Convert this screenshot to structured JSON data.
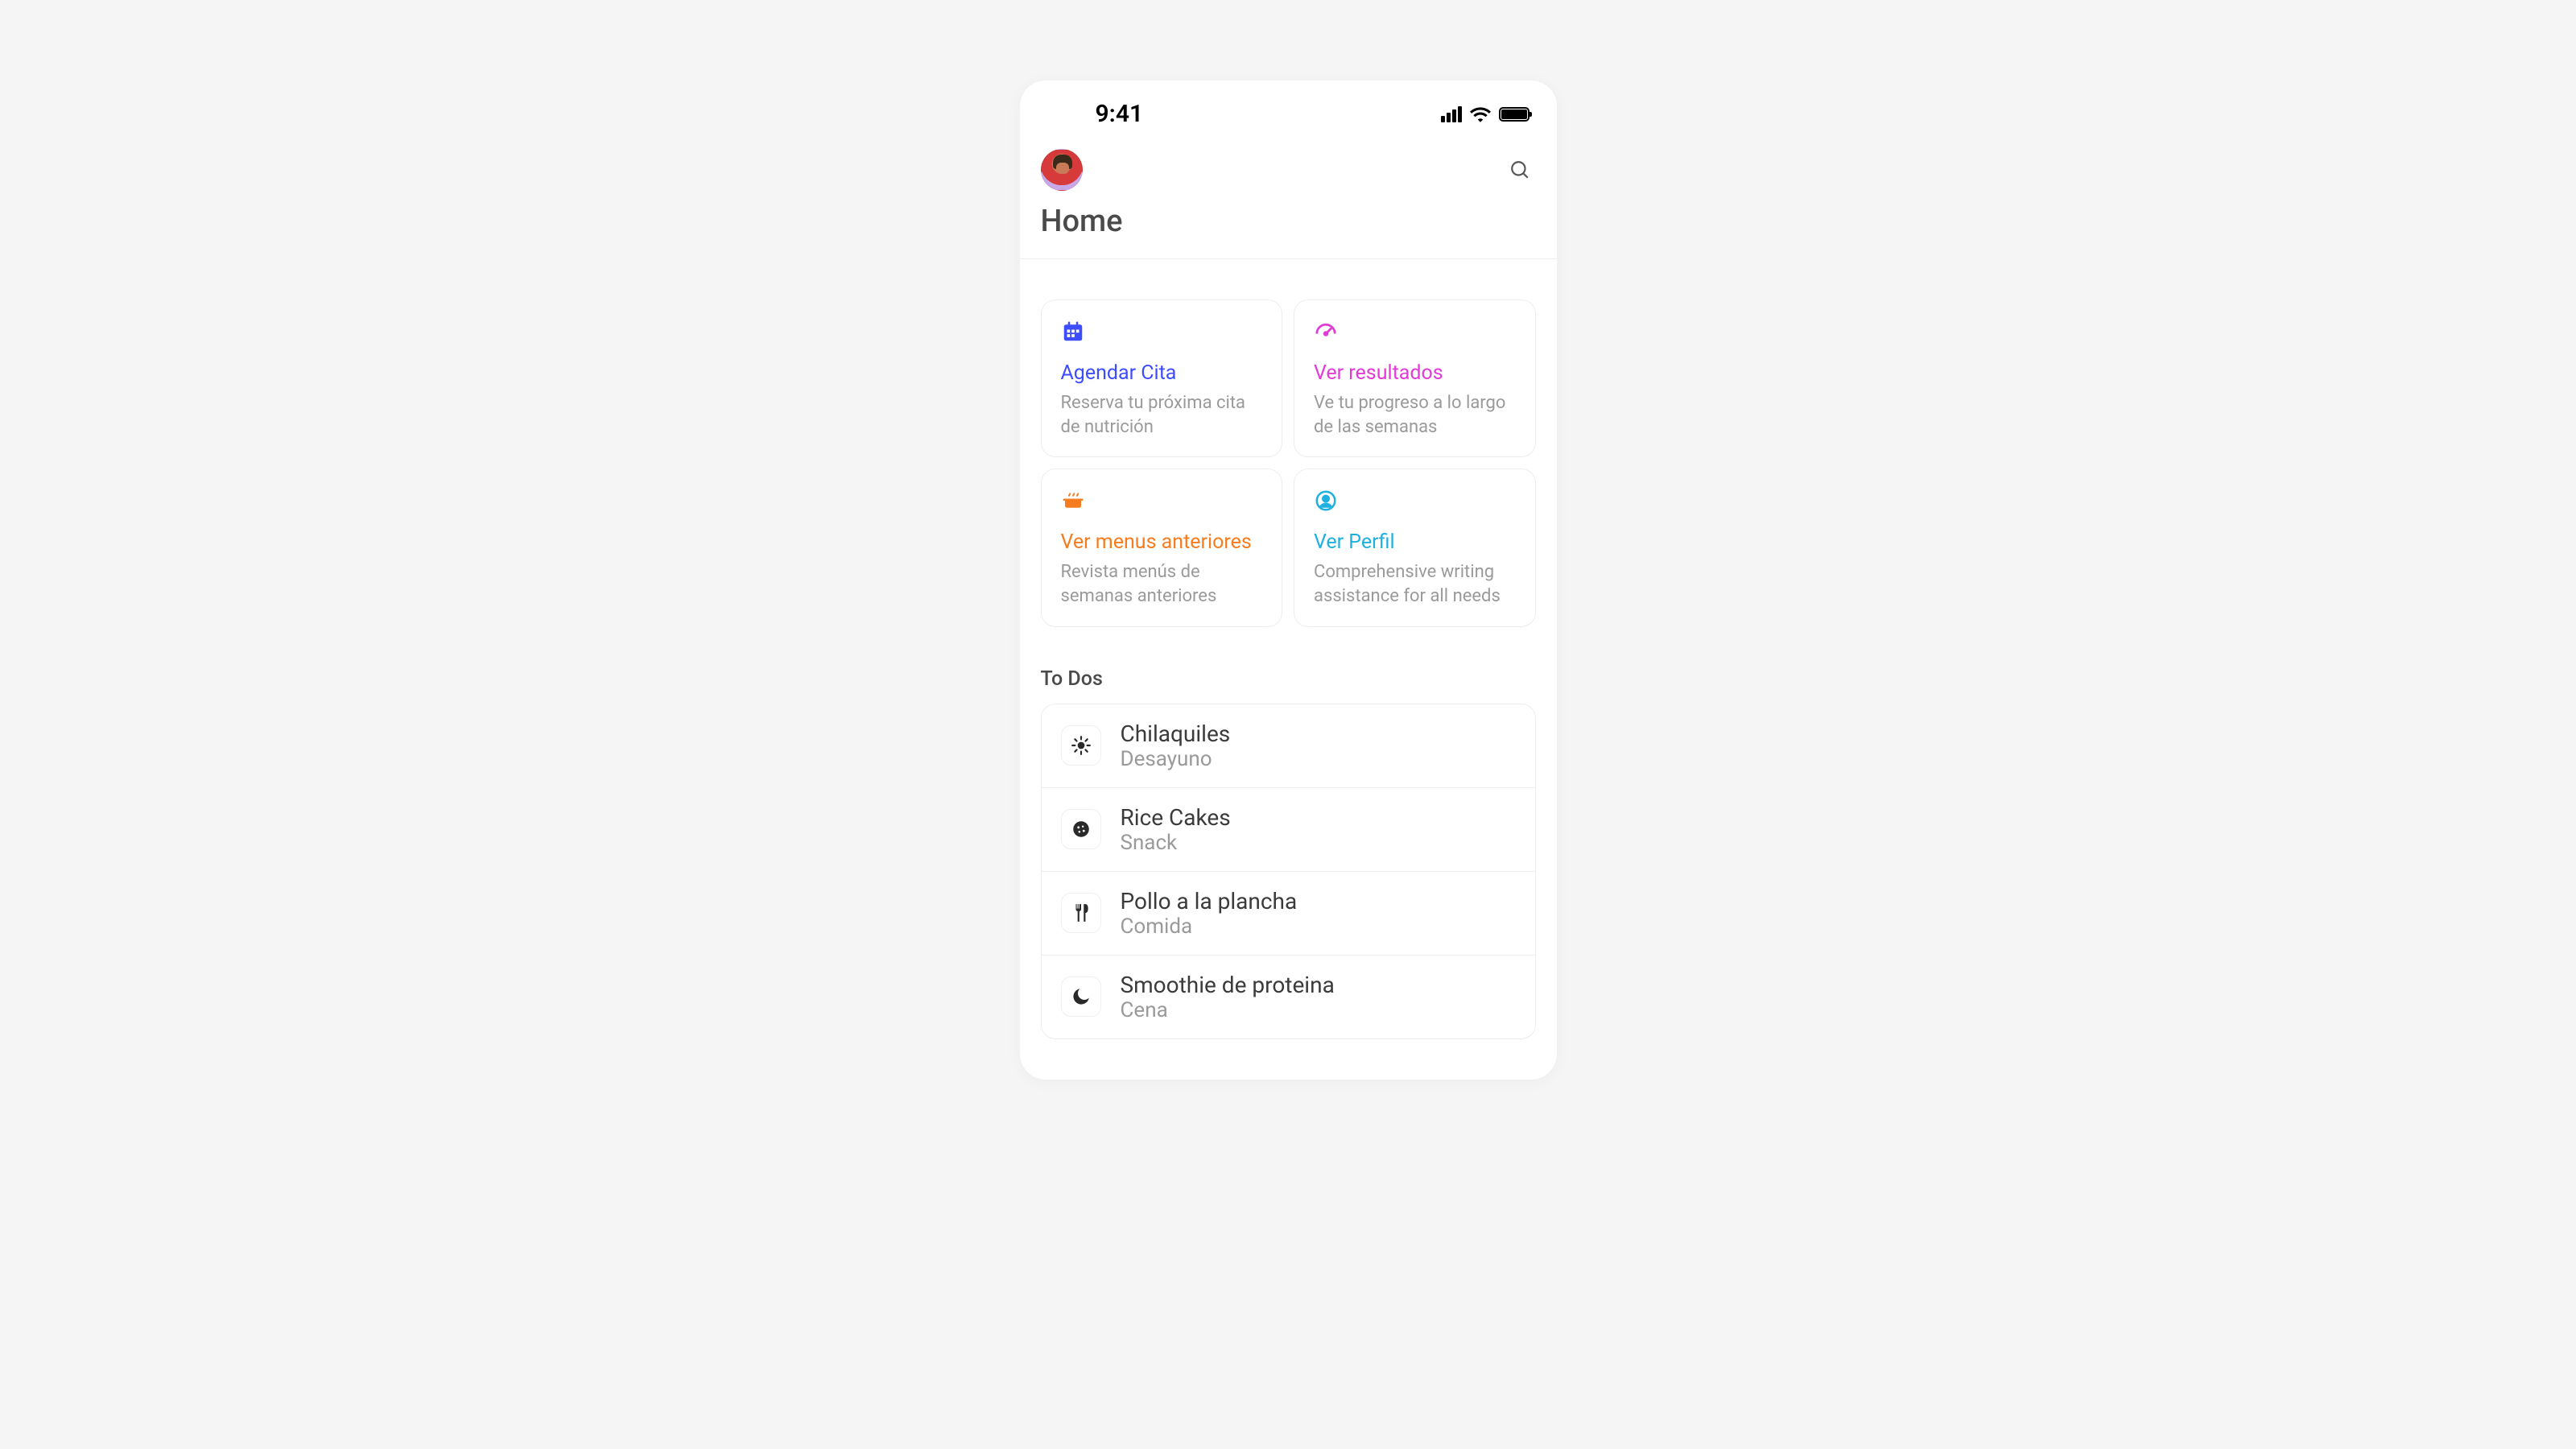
{
  "status": {
    "time": "9:41"
  },
  "header": {
    "title": "Home"
  },
  "cards": [
    {
      "icon": "calendar-icon",
      "title": "Agendar Cita",
      "desc": "Reserva tu próxima cita de nutrición",
      "color": "c-blue"
    },
    {
      "icon": "gauge-icon",
      "title": "Ver resultados",
      "desc": "Ve tu progreso a lo largo de las semanas",
      "color": "c-pink"
    },
    {
      "icon": "pot-icon",
      "title": "Ver menus anteriores",
      "desc": "Revista menús de semanas anteriores",
      "color": "c-orange"
    },
    {
      "icon": "profile-icon",
      "title": "Ver Perfil",
      "desc": "Comprehensive writing assistance for all needs",
      "color": "c-cyan"
    }
  ],
  "todos": {
    "section_title": "To Dos",
    "items": [
      {
        "icon": "sun-icon",
        "title": "Chilaquiles",
        "sub": "Desayuno"
      },
      {
        "icon": "cookie-icon",
        "title": "Rice Cakes",
        "sub": "Snack"
      },
      {
        "icon": "utensils-icon",
        "title": "Pollo a la plancha",
        "sub": "Comida"
      },
      {
        "icon": "moon-icon",
        "title": "Smoothie de proteina",
        "sub": "Cena"
      }
    ]
  }
}
